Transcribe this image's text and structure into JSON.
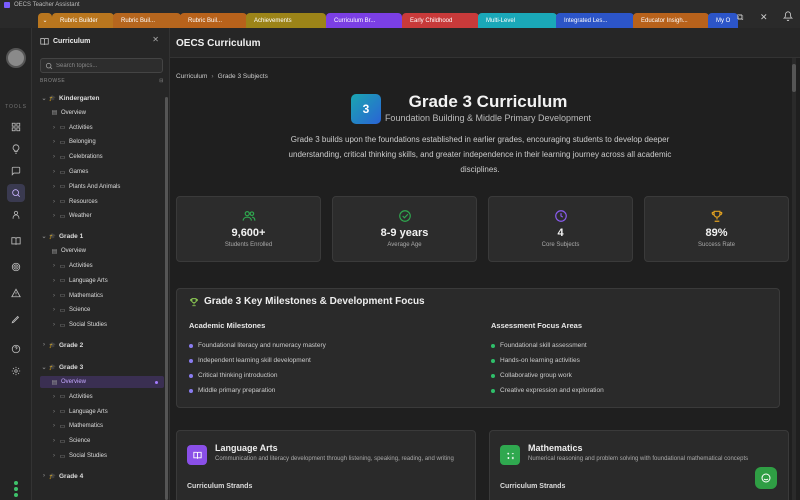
{
  "window": {
    "title": "OECS Teacher Assistant"
  },
  "tabs": [
    {
      "label": "Rubric Builder",
      "color": "#b9761e",
      "text": "#fff"
    },
    {
      "label": "Rubric Buil...",
      "color": "#b6661e",
      "text": "#fff"
    },
    {
      "label": "Rubric Buil...",
      "color": "#b8621b",
      "text": "#fff"
    },
    {
      "label": "Achievements",
      "color": "#9c8418",
      "text": "#fff"
    },
    {
      "label": "Curriculum Br...",
      "color": "#7b3fe4",
      "text": "#fff"
    },
    {
      "label": "Early Childhood",
      "color": "#c83a3a",
      "text": "#fff"
    },
    {
      "label": "Multi-Level",
      "color": "#1aa8b8",
      "text": "#fff"
    },
    {
      "label": "Integrated Les...",
      "color": "#2c55c8",
      "text": "#fff"
    },
    {
      "label": "Educator Insigh...",
      "color": "#b8621b",
      "text": "#fff"
    },
    {
      "label": "My O",
      "color": "#2c55c8",
      "text": "#fff"
    }
  ],
  "rail": {
    "tools_label": "TOOLS"
  },
  "sidebar": {
    "title": "Curriculum",
    "search_placeholder": "Search topics...",
    "browse_label": "BROWSE",
    "tree": [
      {
        "type": "grade",
        "label": "Kindergarten",
        "expanded": true
      },
      {
        "type": "overview",
        "label": "Overview"
      },
      {
        "type": "folder",
        "label": "Activities"
      },
      {
        "type": "folder",
        "label": "Belonging"
      },
      {
        "type": "folder",
        "label": "Celebrations"
      },
      {
        "type": "folder",
        "label": "Games"
      },
      {
        "type": "folder",
        "label": "Plants And Animals"
      },
      {
        "type": "folder",
        "label": "Resources"
      },
      {
        "type": "folder",
        "label": "Weather"
      },
      {
        "type": "grade",
        "label": "Grade 1",
        "expanded": true
      },
      {
        "type": "overview",
        "label": "Overview"
      },
      {
        "type": "folder",
        "label": "Activities"
      },
      {
        "type": "folder",
        "label": "Language Arts"
      },
      {
        "type": "folder",
        "label": "Mathematics"
      },
      {
        "type": "folder",
        "label": "Science"
      },
      {
        "type": "folder",
        "label": "Social Studies"
      },
      {
        "type": "grade",
        "label": "Grade 2",
        "expanded": false
      },
      {
        "type": "grade",
        "label": "Grade 3",
        "expanded": true
      },
      {
        "type": "overview",
        "label": "Overview",
        "selected": true
      },
      {
        "type": "folder",
        "label": "Activities"
      },
      {
        "type": "folder",
        "label": "Language Arts"
      },
      {
        "type": "folder",
        "label": "Mathematics"
      },
      {
        "type": "folder",
        "label": "Science"
      },
      {
        "type": "folder",
        "label": "Social Studies"
      },
      {
        "type": "grade",
        "label": "Grade 4",
        "expanded": false
      }
    ]
  },
  "main": {
    "title": "OECS Curriculum",
    "breadcrumb": {
      "root": "Curriculum",
      "current": "Grade 3 Subjects"
    },
    "hero": {
      "badge": "3",
      "title": "Grade 3 Curriculum",
      "subtitle": "Foundation Building & Middle Primary Development",
      "description": "Grade 3 builds upon the foundations established in earlier grades, encouraging students to develop deeper understanding, critical thinking skills, and greater independence in their learning journey across all academic disciplines."
    },
    "stats": [
      {
        "icon": "users-icon",
        "value": "9,600+",
        "label": "Students Enrolled",
        "color": "#2fa84f"
      },
      {
        "icon": "target-icon",
        "value": "8-9 years",
        "label": "Average Age",
        "color": "#2fa84f"
      },
      {
        "icon": "clock-icon",
        "value": "4",
        "label": "Core Subjects",
        "color": "#8a5cf0"
      },
      {
        "icon": "trophy-icon",
        "value": "89%",
        "label": "Success Rate",
        "color": "#e0a020"
      }
    ],
    "milestones": {
      "title": "Grade 3 Key Milestones & Development Focus",
      "academic": {
        "heading": "Academic Milestones",
        "items": [
          "Foundational literacy and numeracy mastery",
          "Independent learning skill development",
          "Critical thinking introduction",
          "Middle primary preparation"
        ]
      },
      "assessment": {
        "heading": "Assessment Focus Areas",
        "items": [
          "Foundational skill assessment",
          "Hands-on learning activities",
          "Collaborative group work",
          "Creative expression and exploration"
        ]
      }
    },
    "subjects": [
      {
        "title": "Language Arts",
        "description": "Communication and literacy development through listening, speaking, reading, and writing",
        "strands_label": "Curriculum Strands",
        "color": "#8a4fe8"
      },
      {
        "title": "Mathematics",
        "description": "Numerical reasoning and problem solving with foundational mathematical concepts",
        "strands_label": "Curriculum Strands",
        "color": "#2fa84f"
      }
    ]
  },
  "colors": {
    "accent": "#8a5cf0",
    "success": "#2fa84f",
    "bullet_academic": "#8a7cf0",
    "bullet_assessment": "#2fbf6a"
  }
}
